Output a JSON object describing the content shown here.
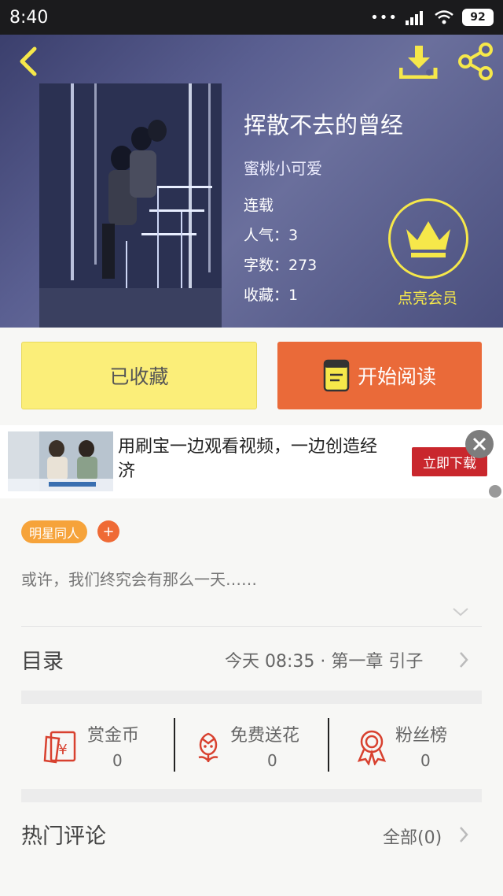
{
  "status_bar": {
    "time": "8:40",
    "signal_dots": "•••",
    "battery": "92"
  },
  "book": {
    "title": "挥散不去的曾经",
    "author": "蜜桃小可爱",
    "status": "连载",
    "popularity": "人气：3",
    "word_count": "字数：273",
    "favorites": "收藏：1"
  },
  "member": {
    "label": "点亮会员"
  },
  "actions": {
    "collected_label": "已收藏",
    "read_label": "开始阅读"
  },
  "ad": {
    "text": "用刷宝一边观看视频，一边创造经济",
    "cta": "立即下载"
  },
  "tags": [
    {
      "label": "明星同人"
    }
  ],
  "tag_add": "+",
  "intro": "或许，我们终究会有那么一天……",
  "catalog": {
    "title": "目录",
    "latest": "今天 08:35 · 第一章 引子"
  },
  "stats": [
    {
      "label": "赏金币",
      "value": "0",
      "icon": "red-envelope-icon"
    },
    {
      "label": "免费送花",
      "value": "0",
      "icon": "flower-icon"
    },
    {
      "label": "粉丝榜",
      "value": "0",
      "icon": "ribbon-medal-icon"
    }
  ],
  "comments": {
    "title": "热门评论",
    "all_label": "全部(0)"
  },
  "colors": {
    "accent_yellow": "#f6e84a",
    "read_orange": "#ea6a39",
    "tag_orange": "#f6a33a",
    "icon_red": "#d8412f"
  }
}
